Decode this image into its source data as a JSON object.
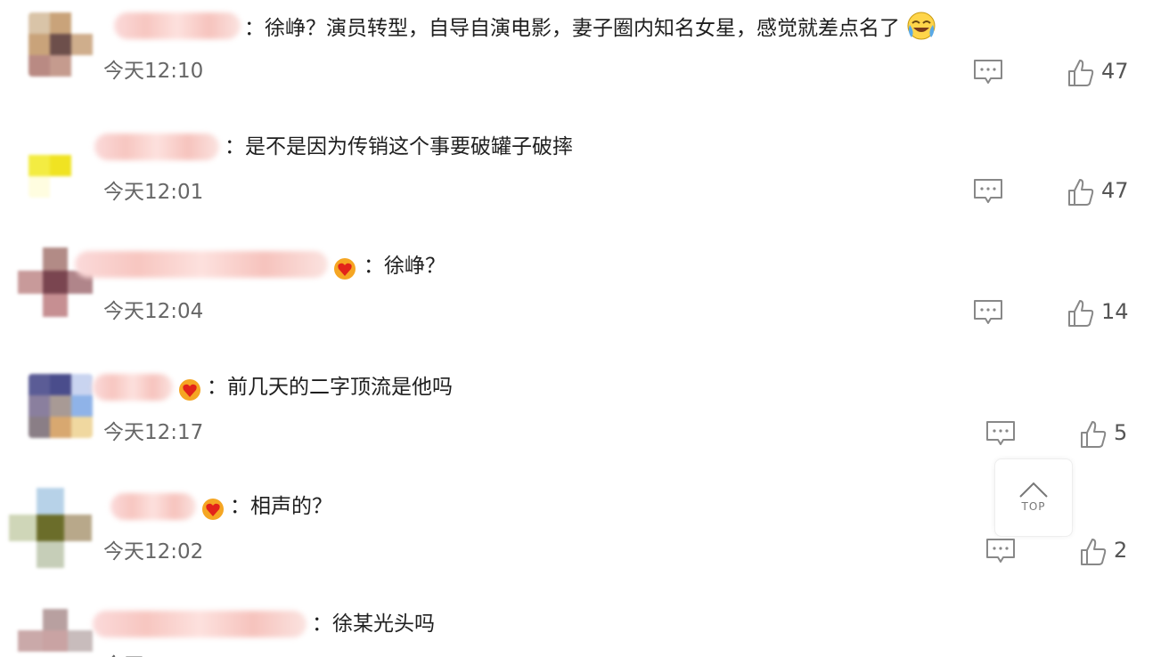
{
  "comments": [
    {
      "body": "：徐峥？演员转型，自导自演电影，妻子圈内知名女星，感觉就差点名了",
      "time": "今天12:10",
      "likes": "47",
      "emoji": "laugh-cry-icon"
    },
    {
      "body": "：是不是因为传销这个事要破罐子破摔",
      "time": "今天12:01",
      "likes": "47"
    },
    {
      "body": "：徐峥？",
      "time": "今天12:04",
      "likes": "14",
      "badge": "vip-heart-icon"
    },
    {
      "body": "：前几天的二字顶流是他吗",
      "time": "今天12:17",
      "likes": "5",
      "badge": "vip-heart-icon"
    },
    {
      "body": "：相声的？",
      "time": "今天12:02",
      "likes": "2",
      "badge": "vip-heart-icon"
    },
    {
      "body": "：徐某光头吗",
      "time": "今天",
      "likes": ""
    }
  ],
  "back_to_top": {
    "label": "TOP"
  },
  "colors": {
    "badge": "#f5a623",
    "badge_heart": "#e2231a",
    "icon": "#888888",
    "text": "#1f1f1f",
    "muted": "#666666"
  }
}
